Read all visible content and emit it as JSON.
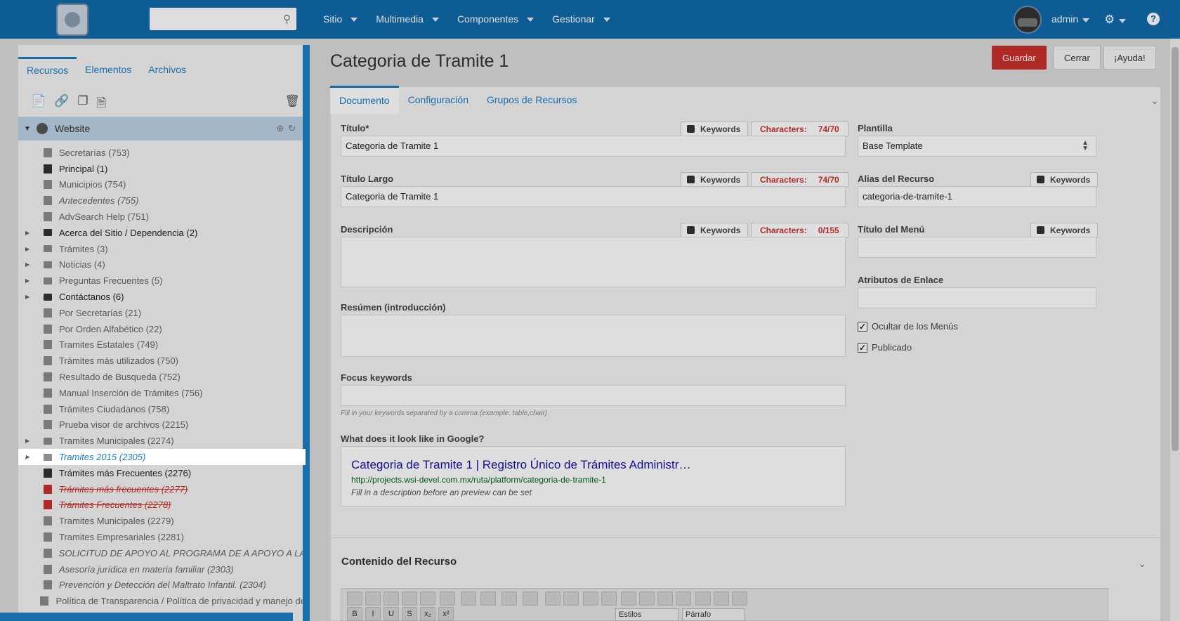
{
  "topbar": {
    "menu": [
      "Sitio",
      "Multimedia",
      "Componentes",
      "Gestionar"
    ],
    "user": "admin"
  },
  "left": {
    "tabs": [
      "Recursos",
      "Elementos",
      "Archivos"
    ],
    "root": "Website",
    "tree": [
      {
        "label": "Secretarías (753)",
        "icon": "doc",
        "style": "muted",
        "arrow": false
      },
      {
        "label": "Principal (1)",
        "icon": "doc",
        "style": "dark",
        "arrow": false
      },
      {
        "label": "Municipios (754)",
        "icon": "doc",
        "style": "muted",
        "arrow": false
      },
      {
        "label": "Antecedentes (755)",
        "icon": "doc",
        "style": "italic",
        "arrow": false
      },
      {
        "label": "AdvSearch Help (751)",
        "icon": "doc",
        "style": "muted",
        "arrow": false
      },
      {
        "label": "Acerca del Sitio / Dependencia (2)",
        "icon": "folder",
        "style": "dark",
        "arrow": true
      },
      {
        "label": "Trámites (3)",
        "icon": "folder",
        "style": "muted",
        "arrow": true
      },
      {
        "label": "Noticias (4)",
        "icon": "folder",
        "style": "muted",
        "arrow": true
      },
      {
        "label": "Preguntas Frecuentes (5)",
        "icon": "folder",
        "style": "muted",
        "arrow": true
      },
      {
        "label": "Contáctanos (6)",
        "icon": "folder",
        "style": "dark",
        "arrow": true
      },
      {
        "label": "Por Secretarías (21)",
        "icon": "doc",
        "style": "muted",
        "arrow": false
      },
      {
        "label": "Por Orden Alfabético (22)",
        "icon": "doc",
        "style": "muted",
        "arrow": false
      },
      {
        "label": "Tramites Estatales (749)",
        "icon": "doc",
        "style": "muted",
        "arrow": false
      },
      {
        "label": "Trámites más utilizados (750)",
        "icon": "doc",
        "style": "muted",
        "arrow": false
      },
      {
        "label": "Resultado de Busqueda (752)",
        "icon": "doc",
        "style": "muted",
        "arrow": false
      },
      {
        "label": "Manual Inserción de Trámites (756)",
        "icon": "doc",
        "style": "muted",
        "arrow": false
      },
      {
        "label": "Trámites Ciudadanos (758)",
        "icon": "doc",
        "style": "muted",
        "arrow": false
      },
      {
        "label": "Prueba visor de archivos (2215)",
        "icon": "doc",
        "style": "muted",
        "arrow": false
      },
      {
        "label": "Tramites Municipales (2274)",
        "icon": "folder",
        "style": "muted",
        "arrow": true
      },
      {
        "label": "Tramites 2015 (2305)",
        "icon": "folder",
        "style": "selected",
        "arrow": true
      },
      {
        "label": "Trámites más Frecuentes (2276)",
        "icon": "doc",
        "style": "dark",
        "arrow": false
      },
      {
        "label": "Trámites más frecuentes (2277)",
        "icon": "red",
        "style": "strike",
        "arrow": false
      },
      {
        "label": "Trámites Frecuentes (2278)",
        "icon": "red",
        "style": "strike",
        "arrow": false
      },
      {
        "label": "Tramites Municipales (2279)",
        "icon": "doc",
        "style": "muted",
        "arrow": false
      },
      {
        "label": "Tramites Empresariales (2281)",
        "icon": "doc",
        "style": "muted",
        "arrow": false
      },
      {
        "label": "SOLICITUD DE APOYO AL PROGRAMA DE A APOYO A LA",
        "icon": "doc",
        "style": "italic",
        "arrow": false
      },
      {
        "label": "Asesoría jurídica en materia familiar (2303)",
        "icon": "doc",
        "style": "italic",
        "arrow": false
      },
      {
        "label": "Prevención y Detección del Maltrato Infantil. (2304)",
        "icon": "doc",
        "style": "italic",
        "arrow": false
      },
      {
        "label": "Política de Transparencia / Política de privacidad y manejo de",
        "icon": "doc",
        "style": "muted",
        "arrow": false
      }
    ]
  },
  "main": {
    "title": "Categoria de Tramite 1",
    "buttons": {
      "save": "Guardar",
      "close": "Cerrar",
      "help": "¡Ayuda!"
    },
    "tabs": [
      "Documento",
      "Configuración",
      "Grupos de Recursos"
    ],
    "keywords_label": "Keywords",
    "characters_label": "Characters:",
    "fields": {
      "titulo": {
        "label": "Título*",
        "value": "Categoria de Tramite 1",
        "count": "74/70"
      },
      "titulo_largo": {
        "label": "Título Largo",
        "value": "Categoria de Tramite 1",
        "count": "74/70"
      },
      "descripcion": {
        "label": "Descripción",
        "value": "",
        "count": "0/155"
      },
      "resumen": {
        "label": "Resúmen (introducción)",
        "value": ""
      },
      "focus": {
        "label": "Focus keywords",
        "value": "",
        "hint": "Fill in your keywords separated by a comma (example: table,chair)"
      },
      "plantilla": {
        "label": "Plantilla",
        "value": "Base Template"
      },
      "alias": {
        "label": "Alias del Recurso",
        "value": "categoria-de-tramite-1"
      },
      "titulo_menu": {
        "label": "Título del Menú",
        "value": ""
      },
      "atributos": {
        "label": "Atributos de Enlace",
        "value": ""
      },
      "ocultar": {
        "label": "Ocultar de los Menús",
        "checked": true
      },
      "publicado": {
        "label": "Publicado",
        "checked": true
      }
    },
    "google": {
      "label": "What does it look like in Google?",
      "title": "Categoria de Tramite 1 | Registro Único de Trámites Administr…",
      "url": "http://projects.wsi-devel.com.mx/ruta/platform/categoria-de-tramite-1",
      "desc": "Fill in a description before an preview can be set"
    },
    "content_title": "Contenido del Recurso",
    "toolbar": {
      "styles": "Estilos",
      "format": "Párrafo"
    }
  }
}
